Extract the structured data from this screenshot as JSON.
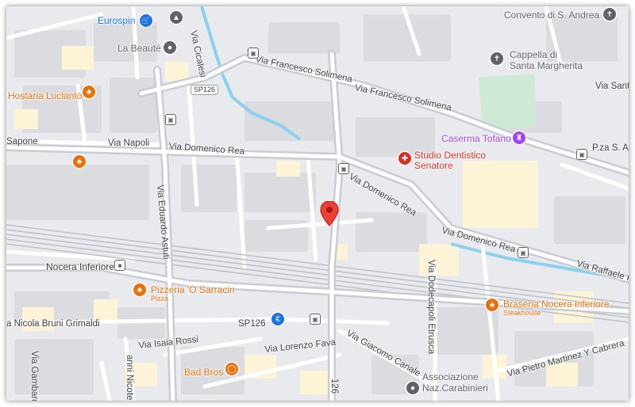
{
  "map": {
    "colors": {
      "background": "#e8eaed",
      "road": "#ffffff",
      "main_road": "#c8cdd3",
      "block": "#dadce0",
      "yellow_block": "#fdf3d6",
      "park": "#ceead6",
      "canal": "#8ad1f0",
      "rail": "#bdc1c6",
      "pin": "#ea4335"
    },
    "streets": {
      "via_cicalesi": "Via Cicalesi",
      "via_francesco_solimena_1": "Via Francesco Solimena",
      "via_francesco_solimena_2": "Via Francesco Solimena",
      "via_napoli": "Via Napoli",
      "via_domenico_rea_1": "Via Domenico Rea",
      "via_domenico_rea_2": "Via Domenico Rea",
      "via_domenico_rea_3": "Via Domenico Rea",
      "via_eduardo_astuti": "Via Eduardo Astuti",
      "via_raffaele": "Via Raffaele I",
      "pza_st": "P.za S. A",
      "via_santa": "Via Sant'A",
      "via_dodecapoli_etrusca": "Via Dodecapoli Etrusca",
      "via_nicola_bruni_grimaldi": "a Nicola Bruni Grimaldi",
      "via_isaia_rossi": "Via Isaia Rossi",
      "via_lorenzo_fava": "Via Lorenzo Fava",
      "via_giacomo_canale": "Via Giacomo Canale",
      "via_pietro_martinez": "Via Pietro Martinez Y Cabrera",
      "gambardella": "Via Gambardella",
      "nicotera": "anni Nicotera",
      "via_126": "126",
      "sapone": "Sapone",
      "sp126_top": "SP126",
      "sp126_bottom": "SP126"
    },
    "places": {
      "eurospin": "Eurospin",
      "la_beaute": "La Beauté",
      "hostaria": "Hostaria Luclantò",
      "convento": "Convento di S. Andrea",
      "cappella_1": "Cappella di",
      "cappella_2": "Santa Margherita",
      "caserma": "Caserma Tofano",
      "studio_1": "Studio Dentistico",
      "studio_2": "Senatore",
      "nocera": "Nocera Inferiore",
      "pizzeria": "Pizzeria 'O Sarracin",
      "pizzeria_sub": "Pizza",
      "braseria": "Braseria Nocera inferiore",
      "braseria_sub": "Steakhouse",
      "bad_bros": "Bad Bros",
      "assoc_1": "Associazione",
      "assoc_2": "Naz.Carabinieri"
    },
    "icons": [
      "shopping-cart-icon",
      "beauty-icon",
      "restaurant-icon",
      "church-icon",
      "castle-icon",
      "hospital-icon",
      "train-icon",
      "bus-stop-icon",
      "bar-icon",
      "map-pin-icon",
      "bank-icon",
      "landmark-icon"
    ]
  }
}
